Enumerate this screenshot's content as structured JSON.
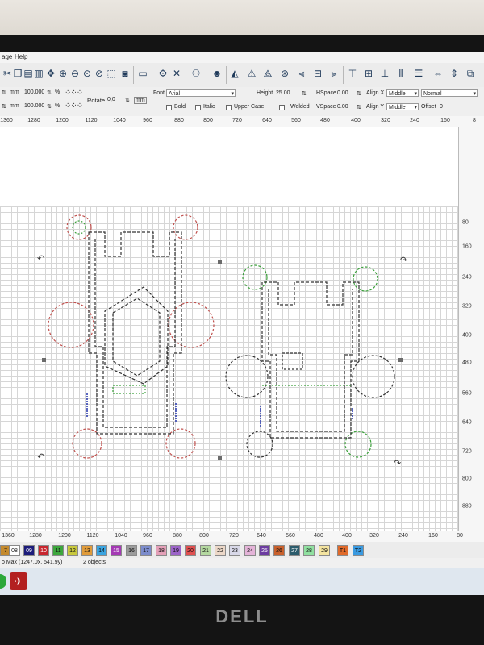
{
  "menu": {
    "items": [
      "age",
      "Help"
    ]
  },
  "toolbar": {
    "icons": [
      "scissors-icon",
      "copy-icon",
      "paste-icon",
      "delete-icon",
      "move-icon",
      "zoom-in-icon",
      "zoom-out-icon",
      "zoom-icon",
      "select-frame-icon",
      "camera-icon",
      "monitor-icon",
      "settings-icon",
      "tools-icon",
      "users-icon",
      "person-icon",
      "trace-icon",
      "warning-icon",
      "node-icon",
      "target-icon",
      "align-left-icon",
      "align-center-icon",
      "align-right-icon",
      "align-top-icon",
      "align-middle-icon",
      "align-bottom-icon",
      "distribute-h-icon",
      "distribute-v-icon",
      "same-width-icon",
      "same-height-icon"
    ]
  },
  "props": {
    "mm1": "mm",
    "mm2": "mm",
    "val1": "100.000",
    "val2": "100.000",
    "pct1": "%",
    "pct2": "%",
    "rotate_label": "Rotate",
    "rotate_value": "0,0",
    "rotate_unit": "mm",
    "font_label": "Font",
    "font_value": "Arial",
    "height_label": "Height",
    "height_value": "25.00",
    "hspace_label": "HSpace",
    "hspace_value": "0.00",
    "vspace_label": "VSpace",
    "vspace_value": "0.00",
    "alignx_label": "Align X",
    "alignx_value": "Middle",
    "aligny_label": "Align Y",
    "aligny_value": "Middle",
    "style_value": "Normal",
    "offset_label": "Offset",
    "offset_value": "0",
    "bold": "Bold",
    "italic": "Italic",
    "upper": "Upper Case",
    "welded": "Welded"
  },
  "ruler_top": [
    "1360",
    "1280",
    "1200",
    "1120",
    "1040",
    "960",
    "880",
    "800",
    "720",
    "640",
    "560",
    "480",
    "400",
    "320",
    "240",
    "160",
    "8"
  ],
  "ruler_right": [
    "80",
    "160",
    "240",
    "320",
    "400",
    "480",
    "560",
    "640",
    "720",
    "800",
    "880"
  ],
  "ruler_bottom": [
    "1360",
    "1280",
    "1200",
    "1120",
    "1040",
    "960",
    "880",
    "800",
    "720",
    "640",
    "560",
    "480",
    "400",
    "320",
    "240",
    "160",
    "80"
  ],
  "palette": [
    {
      "label": "7",
      "color": "#c48a2e"
    },
    {
      "label": "08",
      "color": "#ffffff"
    },
    {
      "label": "09",
      "color": "#1c1c7a"
    },
    {
      "label": "10",
      "color": "#c8262e"
    },
    {
      "label": "11",
      "color": "#3ca63c"
    },
    {
      "label": "12",
      "color": "#c8c83c"
    },
    {
      "label": "13",
      "color": "#e09b3a"
    },
    {
      "label": "14",
      "color": "#3aa4e0"
    },
    {
      "label": "15",
      "color": "#a43ab4"
    },
    {
      "label": "16",
      "color": "#9c9c9c"
    },
    {
      "label": "17",
      "color": "#7c8ccc"
    },
    {
      "label": "18",
      "color": "#e4a0b8"
    },
    {
      "label": "19",
      "color": "#9c64c8"
    },
    {
      "label": "20",
      "color": "#e05050"
    },
    {
      "label": "21",
      "color": "#b4d8a0"
    },
    {
      "label": "22",
      "color": "#ecd8c8"
    },
    {
      "label": "23",
      "color": "#d8d8e8"
    },
    {
      "label": "24",
      "color": "#e4b4d8"
    },
    {
      "label": "25",
      "color": "#6c3ca0"
    },
    {
      "label": "26",
      "color": "#c8602c"
    },
    {
      "label": "27",
      "color": "#2c5c6c"
    },
    {
      "label": "28",
      "color": "#90e0a0"
    },
    {
      "label": "29",
      "color": "#f4e4a0"
    },
    {
      "label": "T1",
      "color": "#e06a2a"
    },
    {
      "label": "T2",
      "color": "#3a9ae0"
    }
  ],
  "status": {
    "coords": "o Max (1247.0x, 541.9y)",
    "objects": "2 objects"
  },
  "bezel": {
    "brand": "DELL"
  },
  "colors": {
    "cut_red": "#c0504d",
    "cut_black": "#222222",
    "cut_green": "#3aa03a",
    "text_blue": "#3040b0"
  }
}
